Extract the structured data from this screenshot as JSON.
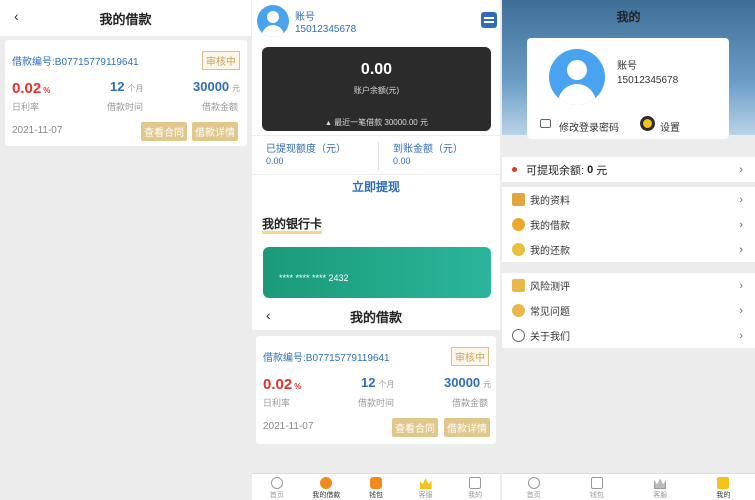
{
  "p1": {
    "title": "我的借款",
    "back": "‹",
    "loan": {
      "no": "借款编号:B07715779119641",
      "status": "审核中",
      "rate": "0.02",
      "rate_unit": "%",
      "rate_label": "日利率",
      "term": "12",
      "term_unit": "个月",
      "term_label": "借款时间",
      "amount": "30000",
      "amount_unit": "元",
      "amount_label": "借款金额",
      "date": "2021-11-07",
      "btn_contract": "查看合同",
      "btn_detail": "借款详情"
    }
  },
  "p2": {
    "account_label": "账号",
    "phone": "15012345678",
    "balance": "0.00",
    "balance_label": "账户余额(元)",
    "last_loan": "最近一笔借款 30000.00 元",
    "withdrawn_label": "已提现额度（元）",
    "withdrawn_value": "0.00",
    "arrived_label": "到账金额（元）",
    "arrived_value": "0.00",
    "withdraw_btn": "立即提现",
    "bank_title": "我的银行卡",
    "card_no": "**** **** **** 2432",
    "title": "我的借款",
    "back": "‹",
    "loan": {
      "no": "借款编号:B07715779119641",
      "status": "审核中",
      "rate": "0.02",
      "rate_unit": "%",
      "rate_label": "日利率",
      "term": "12",
      "term_unit": "个月",
      "term_label": "借款时间",
      "amount": "30000",
      "amount_unit": "元",
      "amount_label": "借款金额",
      "date": "2021-11-07",
      "btn_contract": "查看合同",
      "btn_detail": "借款详情"
    },
    "tabs": [
      "首页",
      "我的借款",
      "钱包",
      "客服",
      "我的"
    ]
  },
  "p3": {
    "title": "我的",
    "account_label": "账号",
    "phone": "15012345678",
    "change_pwd": "修改登录密码",
    "settings": "设置",
    "balance_prefix": "可提现余额:",
    "balance_value": "0",
    "balance_unit": "元",
    "menu1": [
      "我的资料",
      "我的借款",
      "我的还款"
    ],
    "menu2": [
      "风险测评",
      "常见问题",
      "关于我们"
    ],
    "tabs": [
      "首页",
      "钱包",
      "客服",
      "我的"
    ]
  },
  "colors": {
    "blue": "#2f6dbb",
    "red": "#e5312c",
    "gold": "#e0c78c",
    "card": "#1faa8c"
  }
}
